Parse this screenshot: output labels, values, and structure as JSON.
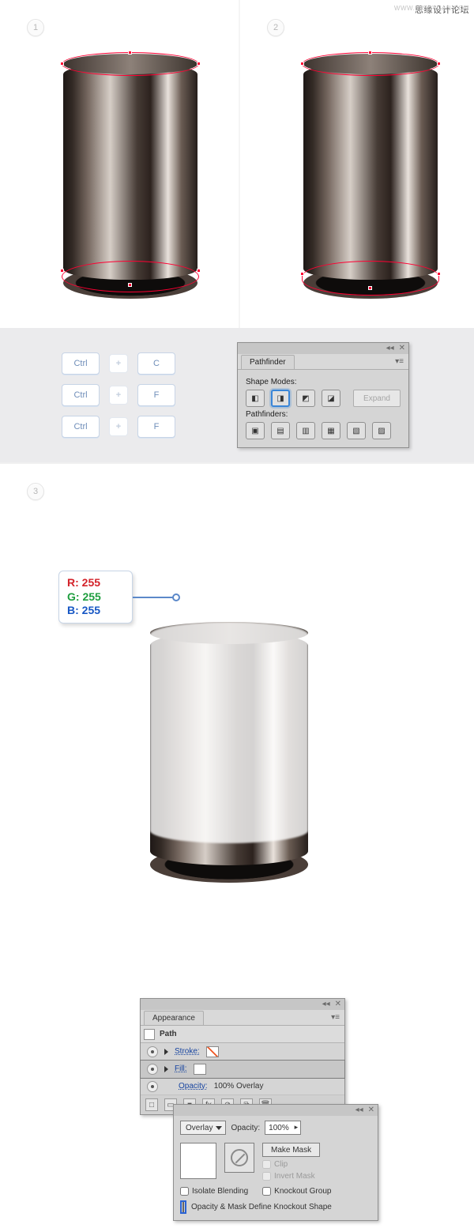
{
  "watermark": {
    "cn": "思缘设计论坛",
    "en": "WWW.MISSYUAN.COM"
  },
  "steps": {
    "s1": "1",
    "s2": "2",
    "s3": "3"
  },
  "shortcuts": {
    "ctrl": "Ctrl",
    "c": "C",
    "f": "F"
  },
  "pathfinder": {
    "title": "Pathfinder",
    "modes_label": "Shape Modes:",
    "pf_label": "Pathfinders:",
    "expand": "Expand"
  },
  "appearance": {
    "title": "Appearance",
    "item": "Path",
    "stroke": "Stroke:",
    "fill": "Fill:",
    "opacity_label": "Opacity:",
    "opacity_text": "100% Overlay"
  },
  "transparency": {
    "blend": "Overlay",
    "opacity_label": "Opacity:",
    "opacity_value": "100%",
    "make_mask": "Make Mask",
    "clip": "Clip",
    "invert": "Invert Mask",
    "isolate": "Isolate Blending",
    "knockout": "Knockout Group",
    "define": "Opacity & Mask Define Knockout Shape"
  },
  "rgb": {
    "r": "R: 255",
    "g": "G: 255",
    "b": "B: 255"
  }
}
